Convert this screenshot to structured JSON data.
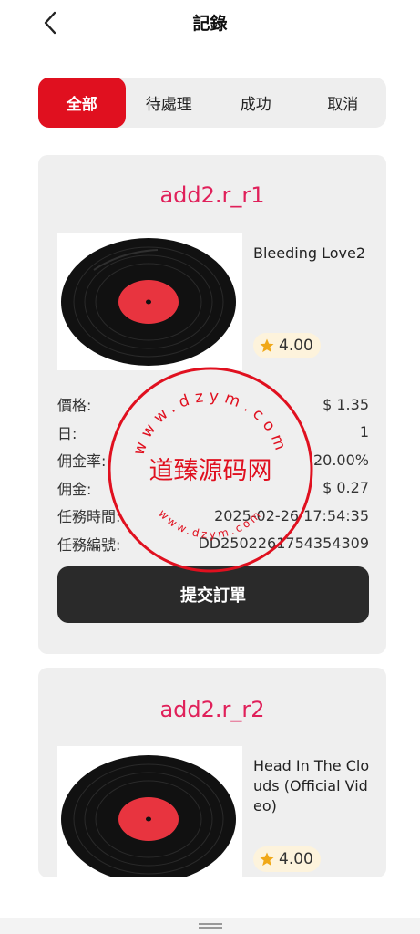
{
  "header": {
    "title": "記錄"
  },
  "tabs": [
    {
      "label": "全部",
      "active": true
    },
    {
      "label": "待處理",
      "active": false
    },
    {
      "label": "成功",
      "active": false
    },
    {
      "label": "取消",
      "active": false
    }
  ],
  "orders": [
    {
      "title": "add2.r_r1",
      "product_name": "Bleeding Love2",
      "rating": "4.00",
      "rows": [
        {
          "label": "價格:",
          "value": "$ 1.35"
        },
        {
          "label": "日:",
          "value": "1"
        },
        {
          "label": "佣金率:",
          "value": "20.00%"
        },
        {
          "label": "佣金:",
          "value": "$ 0.27"
        },
        {
          "label": "任務時間:",
          "value": "2025-02-26 17:54:35"
        },
        {
          "label": "任務編號:",
          "value": "DD2502261754354309"
        }
      ],
      "submit_label": "提交訂單"
    },
    {
      "title": "add2.r_r2",
      "product_name": "Head In The Clouds (Official Video)",
      "rating": "4.00"
    }
  ],
  "watermark": {
    "center_text": "道臻源码网",
    "ring_top": "www.dzym.com",
    "ring_bottom": "www.dzym.com",
    "color": "#e0101f"
  },
  "colors": {
    "accent": "#e0101f",
    "title_pink": "#e0205a",
    "button_dark": "#2a2a2a"
  }
}
